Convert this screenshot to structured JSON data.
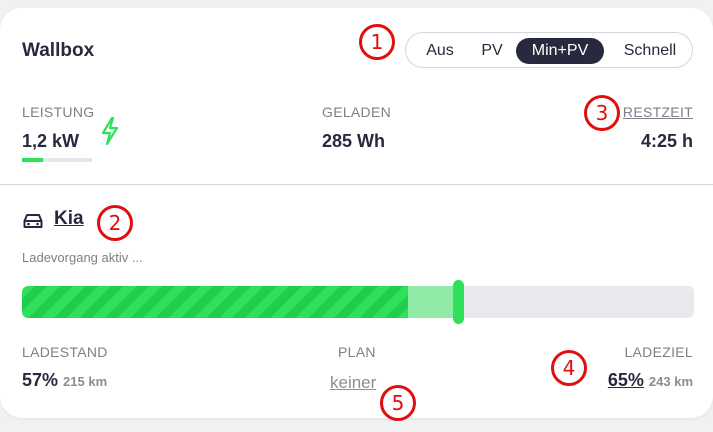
{
  "header": {
    "title": "Wallbox"
  },
  "modes": {
    "items": [
      "Aus",
      "PV",
      "Min+PV",
      "Schnell"
    ],
    "active": "Min+PV"
  },
  "metrics": {
    "power": {
      "label": "LEISTUNG",
      "value": "1,2 kW",
      "bar_fraction": 0.3,
      "bar_color": "#2ee05a"
    },
    "charged": {
      "label": "GELADEN",
      "value": "285 Wh"
    },
    "remaining": {
      "label": "RESTZEIT",
      "value": "4:25 h"
    }
  },
  "vehicle": {
    "icon": "car-icon",
    "name": "Kia",
    "status": "Ladevorgang aktiv ...",
    "soc_fraction": 0.57,
    "plan_fraction": 0.65,
    "fill_color": "#2ee05a"
  },
  "footer": {
    "soc": {
      "label": "LADESTAND",
      "value": "57%",
      "range": "215 km"
    },
    "plan": {
      "label": "PLAN",
      "value": "keiner"
    },
    "target": {
      "label": "LADEZIEL",
      "value": "65%",
      "range": "243 km"
    }
  },
  "annotations": [
    "1",
    "2",
    "3",
    "4",
    "5"
  ],
  "colors": {
    "accent": "#2ee05a",
    "dark": "#28293e",
    "marker": "#e10e0e"
  }
}
